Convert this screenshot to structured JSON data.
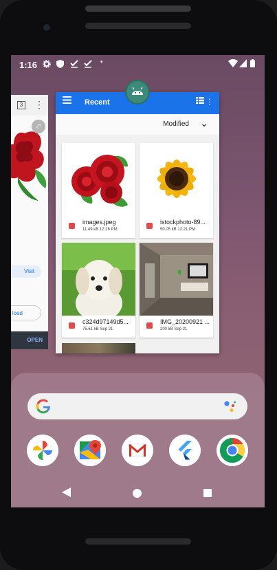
{
  "status_bar": {
    "time": "1:16"
  },
  "left_card": {
    "tab_count": "3",
    "visit_label": "Visit",
    "download_label": "load",
    "open_label": "OPEN"
  },
  "files_app": {
    "title": "Recent",
    "sort_label": "Modified",
    "files": [
      {
        "name": "images.jpeg",
        "meta": "11.49 kB 12:26 PM"
      },
      {
        "name": "istockphoto-89...",
        "meta": "50.05 kB 12:21 PM"
      },
      {
        "name": "c324d97149d5...",
        "meta": "75.61 kB Sep 21"
      },
      {
        "name": "IMG_20200921 ...",
        "meta": "200 kB Sep 21"
      }
    ]
  },
  "dock": {
    "apps": [
      "Photos",
      "Maps",
      "Gmail",
      "Flutter",
      "Chrome"
    ]
  },
  "colors": {
    "accent": "#1a73e8",
    "wallpaper": "#7d5670"
  }
}
